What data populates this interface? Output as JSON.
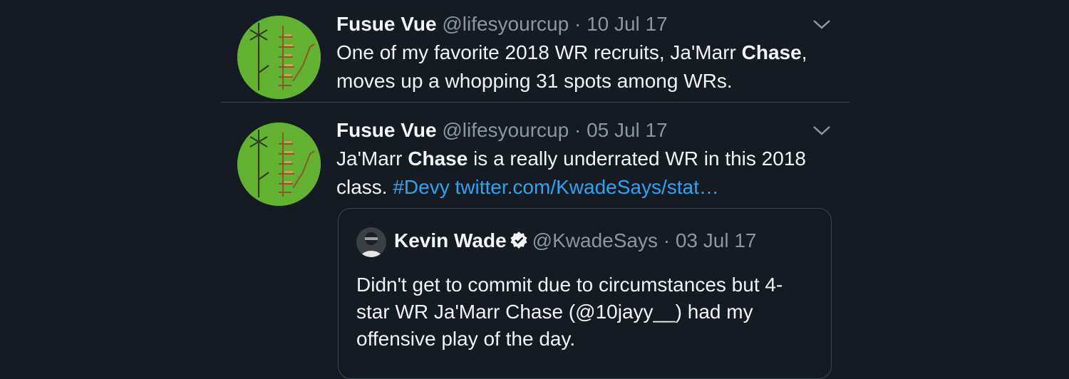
{
  "tweets": [
    {
      "name": "Fusue Vue",
      "handle": "@lifesyourcup",
      "sep": " · ",
      "date": "10 Jul 17",
      "text_parts": [
        "One of my favorite 2018 WR recruits, Ja'Marr ",
        "Chase",
        ",",
        "moves up a whopping 31 spots among WRs."
      ]
    },
    {
      "name": "Fusue Vue",
      "handle": "@lifesyourcup",
      "sep": " · ",
      "date": "05 Jul 17",
      "text_parts": [
        "Ja'Marr ",
        "Chase",
        " is a really underrated WR in this 2018",
        "class. "
      ],
      "hashtag": "#Devy",
      "link": "twitter.com/KwadeSays/stat…",
      "quote": {
        "name": "Kevin Wade",
        "handle": "@KwadeSays",
        "sep": " · ",
        "date": "03 Jul 17",
        "lines": [
          "Didn't get to commit due to circumstances but 4-",
          "star WR Ja'Marr Chase (@10jayy__) had my",
          "offensive play of the day."
        ]
      }
    }
  ],
  "icons": {
    "avatar": "green-diagram-avatar",
    "caret": "chevron-down-icon",
    "verified": "verified-badge-icon",
    "quote_avatar": "profile-photo-avatar"
  },
  "colors": {
    "background": "#151b23",
    "text": "#f2f4f6",
    "muted": "#8a96a3",
    "link": "#2ea3f2",
    "avatar_green": "#62b131",
    "divider": "#3a4452"
  }
}
